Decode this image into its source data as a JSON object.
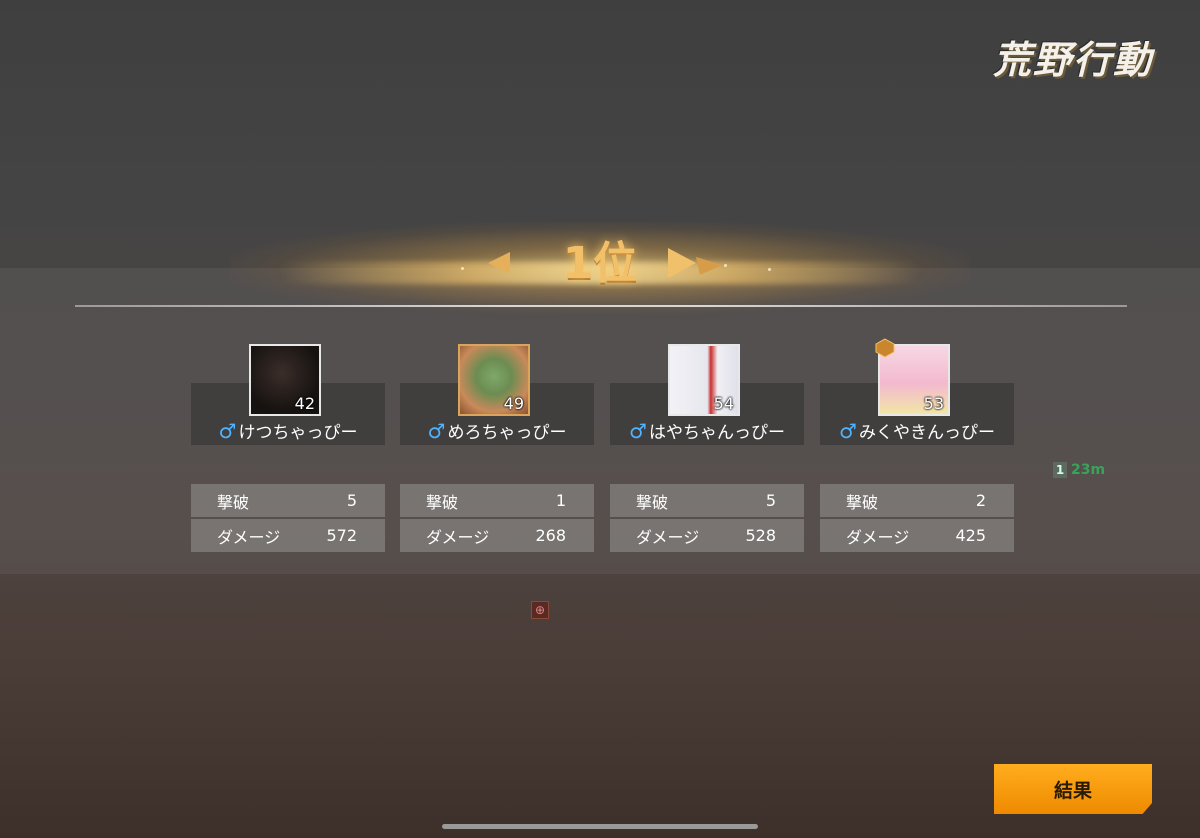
{
  "logo": {
    "text": "荒野行動"
  },
  "rank": {
    "text": "1位"
  },
  "players": [
    {
      "name": "けつちゃっぴー",
      "level": "42",
      "gender_icon": "♂",
      "kills_label": "撃破",
      "kills": "5",
      "damage_label": "ダメージ",
      "damage": "572"
    },
    {
      "name": "めろちゃっぴー",
      "level": "49",
      "gender_icon": "♂",
      "kills_label": "撃破",
      "kills": "1",
      "damage_label": "ダメージ",
      "damage": "268"
    },
    {
      "name": "はやちゃんっぴー",
      "level": "54",
      "gender_icon": "♂",
      "kills_label": "撃破",
      "kills": "5",
      "damage_label": "ダメージ",
      "damage": "528"
    },
    {
      "name": "みくやきんっぴー",
      "level": "53",
      "gender_icon": "♂",
      "kills_label": "撃破",
      "kills": "2",
      "damage_label": "ダメージ",
      "damage": "425"
    }
  ],
  "distance": {
    "number": "1",
    "value": "23m"
  },
  "result_button": {
    "label": "結果"
  },
  "colors": {
    "accent": "#f3c06a",
    "button": "#f39a0c",
    "male": "#4fb3ff"
  }
}
